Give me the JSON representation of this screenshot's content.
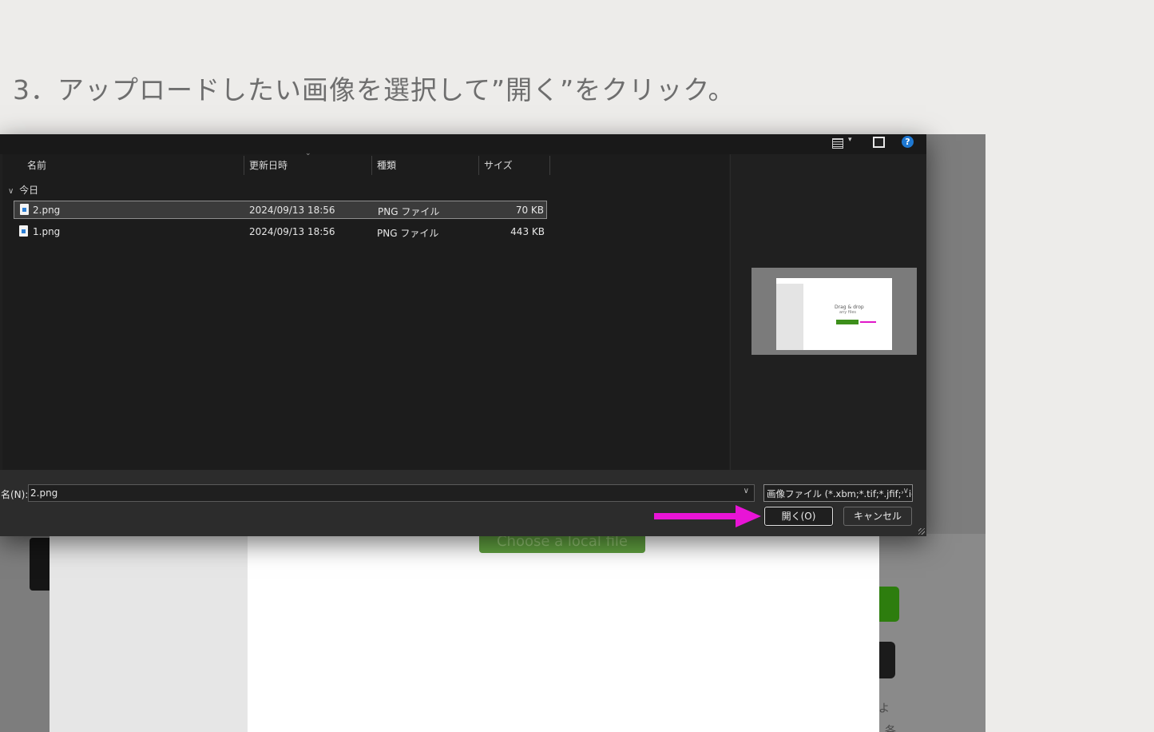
{
  "heading": "3．アップロードしたい画像を選択して”開く”をクリック。",
  "background_page": {
    "choose_button_label": "Choose a local file",
    "right_fragment_1": "よ",
    "right_fragment_2": "各"
  },
  "dialog": {
    "toolbar_icons": [
      "view-options-icon",
      "preview-pane-icon",
      "help-icon"
    ],
    "help_glyph": "?",
    "columns": {
      "name": "名前",
      "modified": "更新日時",
      "type": "種類",
      "size": "サイズ"
    },
    "group_label": "今日",
    "files": [
      {
        "name": "2.png",
        "modified": "2024/09/13 18:56",
        "type": "PNG ファイル",
        "size": "70 KB",
        "selected": true
      },
      {
        "name": "1.png",
        "modified": "2024/09/13 18:56",
        "type": "PNG ファイル",
        "size": "443 KB",
        "selected": false
      }
    ],
    "preview": {
      "title_line1": "Drag & drop",
      "title_line2": "any files"
    },
    "filename_label": "名(N):",
    "filename_value": "2.png",
    "filter_value": "画像ファイル (*.xbm;*.tif;*.jfif;*.ico",
    "open_button": "開く(O)",
    "cancel_button": "キャンセル"
  },
  "colors": {
    "annotation_arrow": "#e814d6",
    "dialog_bg": "#202020",
    "page_bg": "#edecea"
  }
}
